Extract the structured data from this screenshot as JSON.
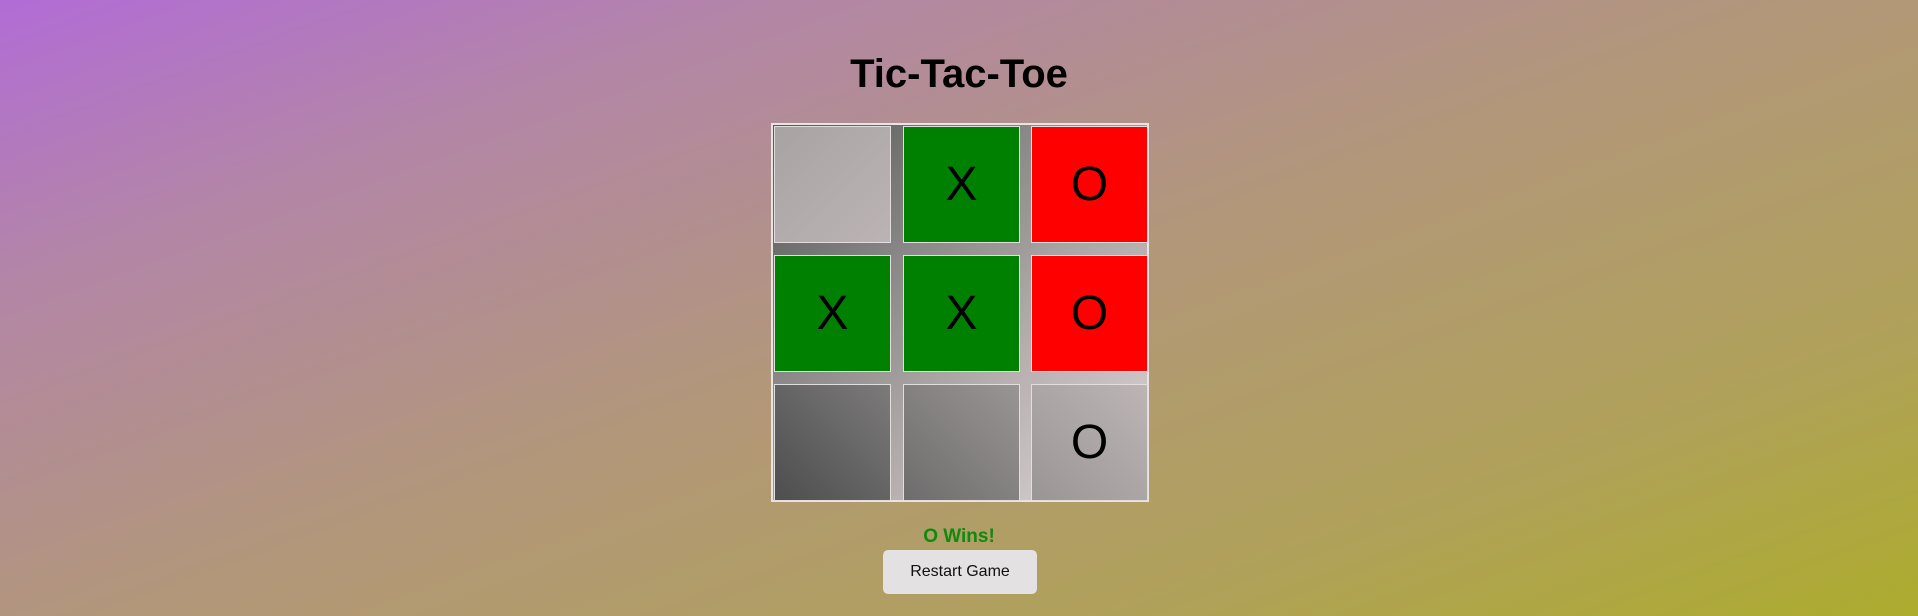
{
  "title": "Tic-Tac-Toe",
  "board": {
    "cells": [
      "",
      "X",
      "O",
      "X",
      "X",
      "O",
      "",
      "",
      "O"
    ]
  },
  "status": "O Wins!",
  "restart_label": "Restart Game",
  "colors": {
    "x_cell": "#008000",
    "o_cell": "#ff0000",
    "status_text": "#0e8a0e"
  }
}
